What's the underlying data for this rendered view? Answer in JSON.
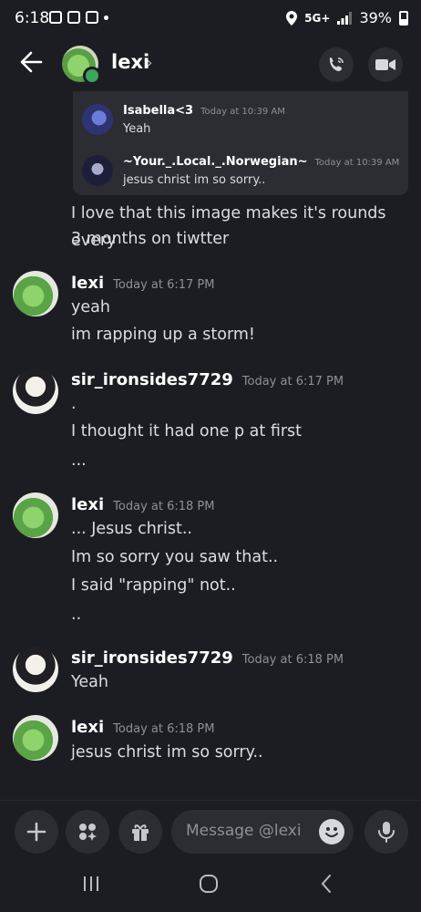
{
  "status": {
    "time": "6:18",
    "network": "5G+",
    "battery": "39%"
  },
  "header": {
    "name": "lexi",
    "chevron": "›"
  },
  "embed": {
    "rows": [
      {
        "name": "Isabella<3",
        "time": "Today at 10:39 AM",
        "text": "Yeah"
      },
      {
        "name": "~Your._.Local._.Norwegian~",
        "time": "Today at 10:39 AM",
        "text": "jesus christ im so sorry.."
      }
    ]
  },
  "messages": {
    "m0": {
      "line1": "I love that this image makes it's rounds every",
      "line2": "3 months on tiwtter"
    },
    "m1": {
      "name": "lexi",
      "time": "Today at 6:17 PM",
      "lines": [
        "yeah",
        "im rapping up a storm!"
      ]
    },
    "m2": {
      "name": "sir_ironsides7729",
      "time": "Today at 6:17 PM",
      "lines": [
        ".",
        "I thought it had one p at first",
        "..."
      ]
    },
    "m3": {
      "name": "lexi",
      "time": "Today at 6:18 PM",
      "lines": [
        "... Jesus christ..",
        "Im so sorry you saw that..",
        "I said \"rapping\" not..",
        ".."
      ]
    },
    "m4": {
      "name": "sir_ironsides7729",
      "time": "Today at 6:18 PM",
      "lines": [
        "Yeah"
      ]
    },
    "m5": {
      "name": "lexi",
      "time": "Today at 6:18 PM",
      "lines": [
        "jesus christ im so sorry.."
      ]
    }
  },
  "composer": {
    "placeholder": "Message @lexi"
  }
}
